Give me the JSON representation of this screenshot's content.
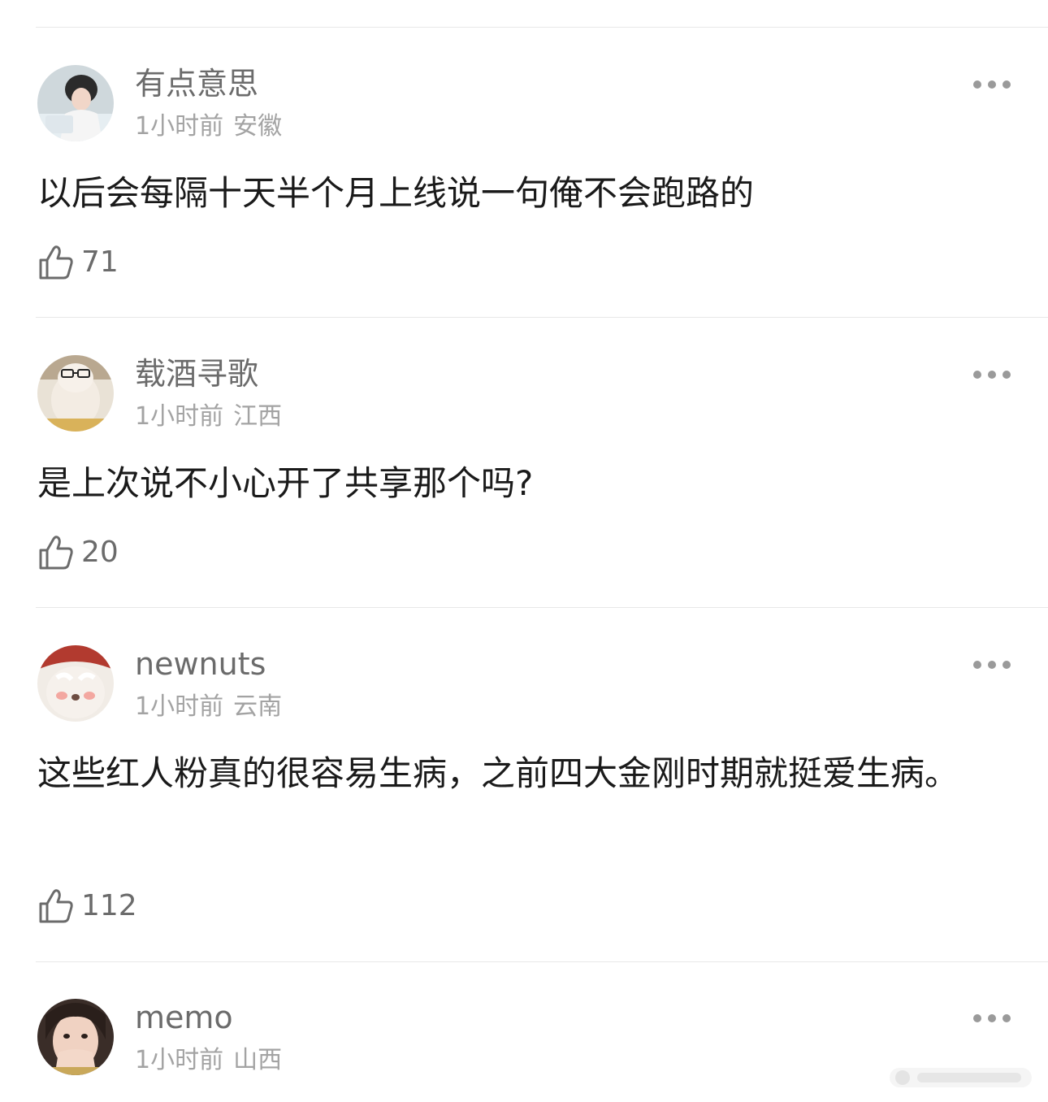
{
  "comments": [
    {
      "username": "有点意思",
      "time": "1小时前",
      "location": "安徽",
      "text": "以后会每隔十天半个月上线说一句俺不会跑路的",
      "likes": "71"
    },
    {
      "username": "载酒寻歌",
      "time": "1小时前",
      "location": "江西",
      "text": "是上次说不小心开了共享那个吗?",
      "likes": "20"
    },
    {
      "username": "newnuts",
      "time": "1小时前",
      "location": "云南",
      "text": "这些红人粉真的很容易生病，之前四大金刚时期就挺爱生病。",
      "likes": "112"
    },
    {
      "username": "memo",
      "time": "1小时前",
      "location": "山西"
    }
  ],
  "icons": {
    "like": "thumbs-up-icon",
    "more": "more-dots-icon"
  },
  "colors": {
    "username": "#6b6b6b",
    "meta": "#a3a3a3",
    "text": "#1a1a1a",
    "divider": "#e8e8e8"
  }
}
